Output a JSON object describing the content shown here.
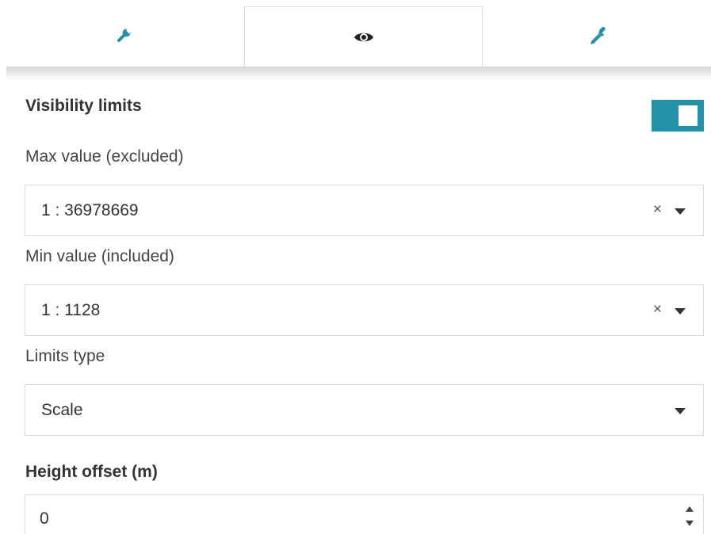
{
  "tabs": [
    {
      "icon": "wrench-icon",
      "active": false
    },
    {
      "icon": "eye-icon",
      "active": true
    },
    {
      "icon": "eyedropper-icon",
      "active": false
    }
  ],
  "colors": {
    "accent": "#2391a6"
  },
  "visibility": {
    "title": "Visibility limits",
    "enabled": true
  },
  "max_value": {
    "label": "Max value (excluded)",
    "value": "1 : 36978669",
    "clear": "×"
  },
  "min_value": {
    "label": "Min value (included)",
    "value": "1 : 1128",
    "clear": "×"
  },
  "limits_type": {
    "label": "Limits type",
    "value": "Scale"
  },
  "height_offset": {
    "label": "Height offset (m)",
    "value": "0"
  }
}
